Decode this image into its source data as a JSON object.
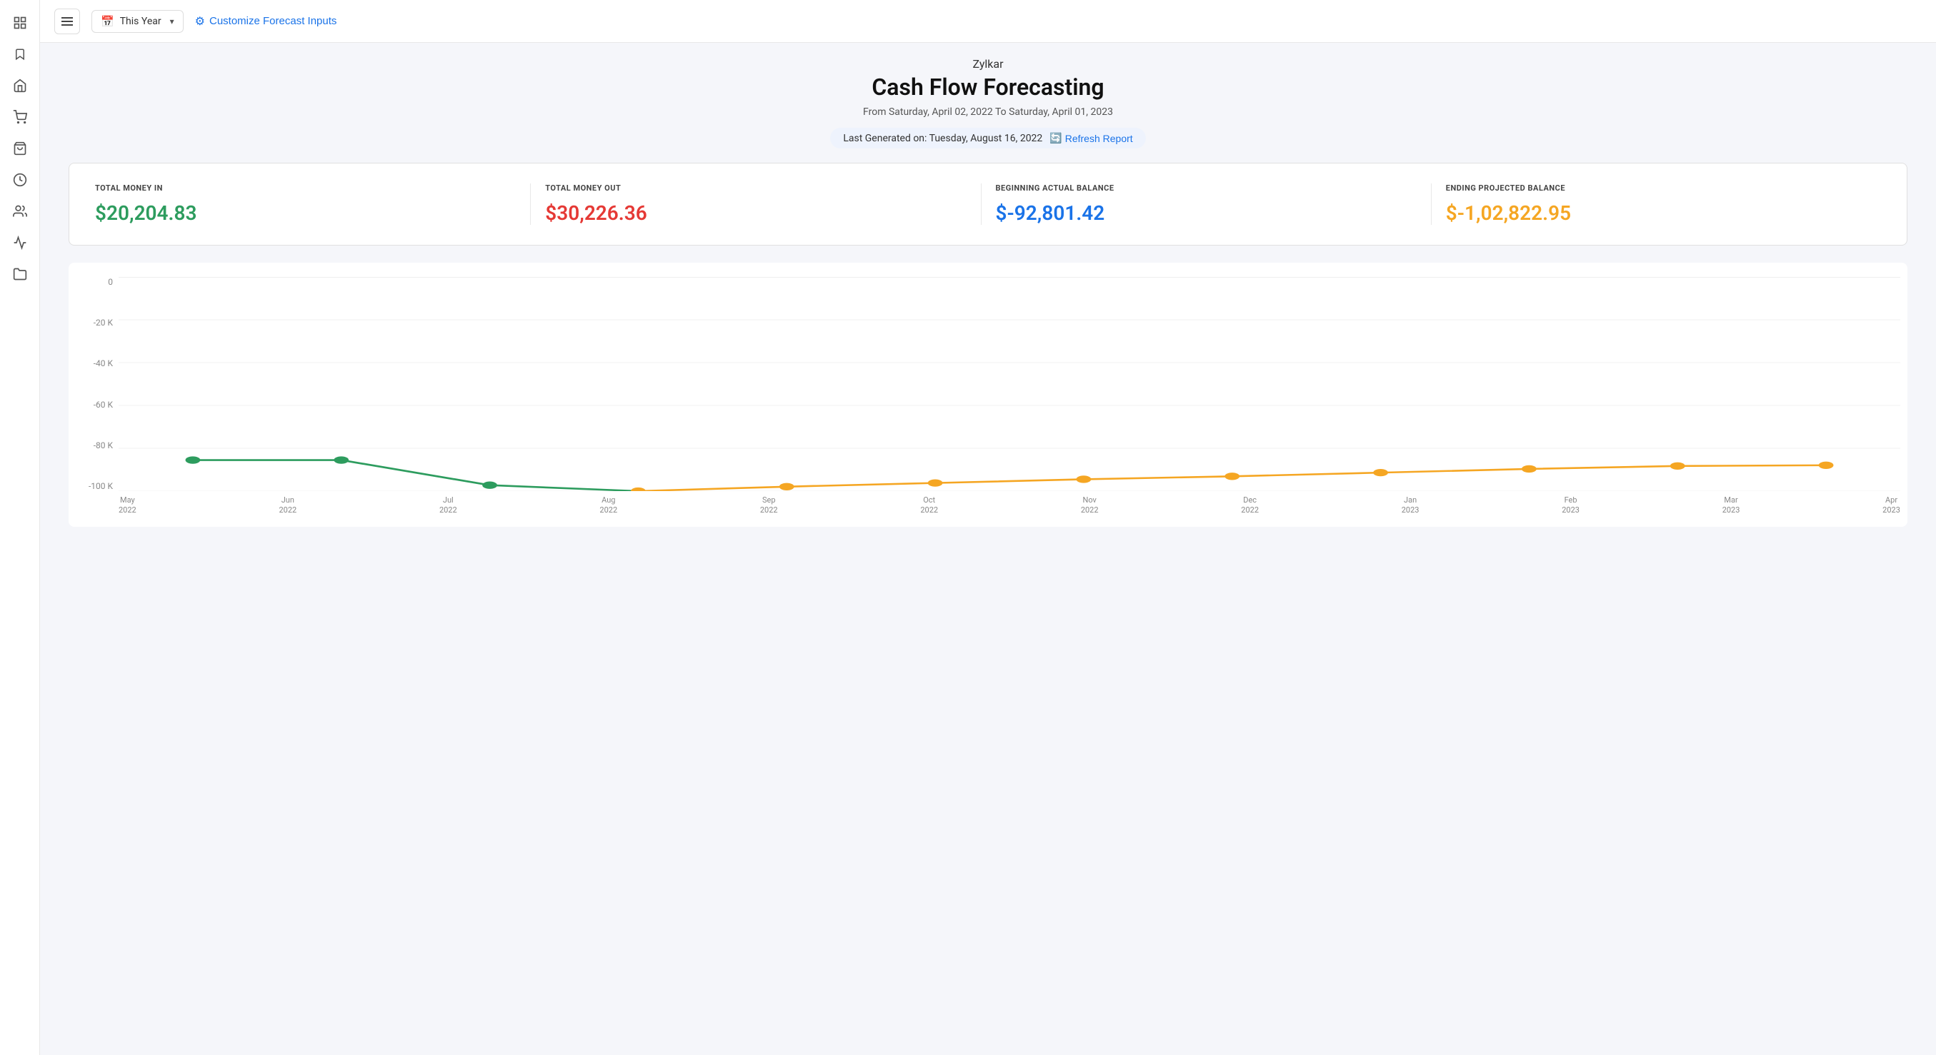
{
  "sidebar": {
    "icons": [
      {
        "name": "home-icon",
        "symbol": "⊞"
      },
      {
        "name": "bookmark-icon",
        "symbol": "🔖"
      },
      {
        "name": "building-icon",
        "symbol": "🏛"
      },
      {
        "name": "cart-icon",
        "symbol": "🛒"
      },
      {
        "name": "bag-icon",
        "symbol": "🛍"
      },
      {
        "name": "clock-icon",
        "symbol": "⏱"
      },
      {
        "name": "people-icon",
        "symbol": "👥"
      },
      {
        "name": "chart-icon",
        "symbol": "📈"
      },
      {
        "name": "folder-icon",
        "symbol": "📁"
      }
    ]
  },
  "toolbar": {
    "menu_label": "≡",
    "date_picker_label": "This Year",
    "customize_label": "Customize Forecast Inputs"
  },
  "report": {
    "company": "Zylkar",
    "title": "Cash Flow Forecasting",
    "date_range": "From Saturday, April 02, 2022 To Saturday, April 01, 2023",
    "generated_label": "Last Generated on: Tuesday, August 16, 2022",
    "refresh_label": "Refresh Report"
  },
  "summary": {
    "cards": [
      {
        "label": "TOTAL MONEY IN",
        "value": "$20,204.83",
        "color": "green"
      },
      {
        "label": "TOTAL MONEY OUT",
        "value": "$30,226.36",
        "color": "red"
      },
      {
        "label": "BEGINNING ACTUAL BALANCE",
        "value": "$-92,801.42",
        "color": "blue"
      },
      {
        "label": "ENDING PROJECTED BALANCE",
        "value": "$-1,02,822.95",
        "color": "orange"
      }
    ]
  },
  "chart": {
    "y_labels": [
      "0",
      "-20 K",
      "-40 K",
      "-60 K",
      "-80 K",
      "-100 K"
    ],
    "x_labels": [
      {
        "month": "May",
        "year": "2022"
      },
      {
        "month": "Jun",
        "year": "2022"
      },
      {
        "month": "Jul",
        "year": "2022"
      },
      {
        "month": "Aug",
        "year": "2022"
      },
      {
        "month": "Sep",
        "year": "2022"
      },
      {
        "month": "Oct",
        "year": "2022"
      },
      {
        "month": "Nov",
        "year": "2022"
      },
      {
        "month": "Dec",
        "year": "2022"
      },
      {
        "month": "Jan",
        "year": "2023"
      },
      {
        "month": "Feb",
        "year": "2023"
      },
      {
        "month": "Mar",
        "year": "2023"
      },
      {
        "month": "Apr",
        "year": "2023"
      }
    ],
    "green_line_color": "#2d9c5e",
    "orange_line_color": "#f5a623"
  }
}
